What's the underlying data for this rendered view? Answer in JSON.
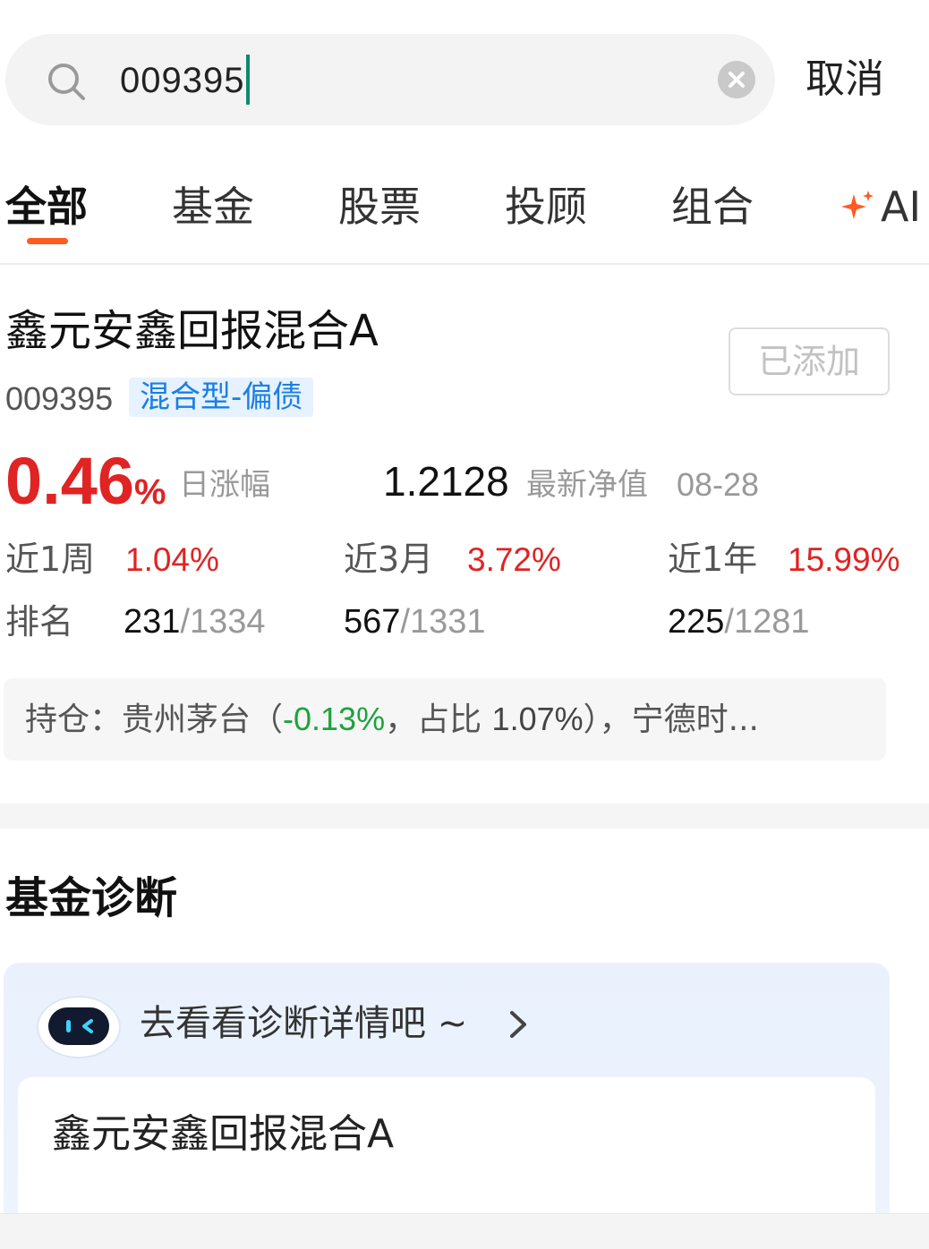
{
  "search": {
    "query": "009395",
    "cancel_label": "取消"
  },
  "tabs": [
    {
      "label": "全部",
      "active": true
    },
    {
      "label": "基金"
    },
    {
      "label": "股票"
    },
    {
      "label": "投顾"
    },
    {
      "label": "组合"
    },
    {
      "label": "AI"
    }
  ],
  "fund": {
    "name": "鑫元安鑫回报混合A",
    "added_label": "已添加",
    "code": "009395",
    "type": "混合型-偏债",
    "daily_change": "0.46",
    "daily_change_unit": "%",
    "daily_change_label": "日涨幅",
    "nav": "1.2128",
    "nav_label": "最新净值",
    "nav_date": "08-28",
    "performance": [
      {
        "label": "近1周",
        "value": "1.04%"
      },
      {
        "label": "近3月",
        "value": "3.72%"
      },
      {
        "label": "近1年",
        "value": "15.99%"
      }
    ],
    "rank_label": "排名",
    "ranks": [
      {
        "position": "231",
        "total": "/1334"
      },
      {
        "position": "567",
        "total": "/1331"
      },
      {
        "position": "225",
        "total": "/1281"
      }
    ],
    "holdings": {
      "prefix": "持仓：贵州茅台（",
      "change": "-0.13%",
      "mid": "，占比 ",
      "share": "1.07%",
      "suffix": "），宁德时..."
    }
  },
  "diagnosis": {
    "section_title": "基金诊断",
    "link_text": "去看看诊断详情吧 ~",
    "fund_name": "鑫元安鑫回报混合A"
  },
  "colors": {
    "accent_orange": "#ff5a1f",
    "up_red": "#e02323",
    "down_green": "#1ba33c",
    "badge_blue": "#1a7fe3"
  }
}
